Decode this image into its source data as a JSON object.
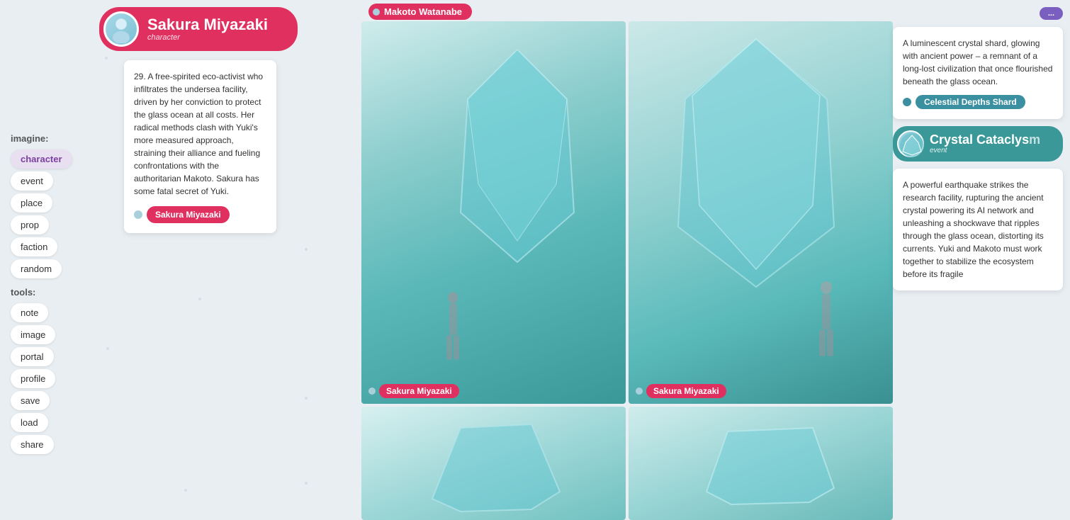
{
  "sidebar": {
    "imagine_label": "imagine:",
    "tools_label": "tools:",
    "imagine_items": [
      {
        "id": "character",
        "label": "character",
        "active": true
      },
      {
        "id": "event",
        "label": "event",
        "active": false
      },
      {
        "id": "place",
        "label": "place",
        "active": false
      },
      {
        "id": "prop",
        "label": "prop",
        "active": false
      },
      {
        "id": "faction",
        "label": "faction",
        "active": false
      },
      {
        "id": "random",
        "label": "random",
        "active": false
      }
    ],
    "tools_items": [
      {
        "id": "note",
        "label": "note"
      },
      {
        "id": "image",
        "label": "image"
      },
      {
        "id": "portal",
        "label": "portal"
      },
      {
        "id": "profile",
        "label": "profile"
      },
      {
        "id": "save",
        "label": "save"
      },
      {
        "id": "load",
        "label": "load"
      },
      {
        "id": "share",
        "label": "share"
      }
    ]
  },
  "character": {
    "name": "Sakura Miyazaki",
    "type_label": "character",
    "description": "29. A free-spirited eco-activist who infiltrates the undersea facility, driven by her conviction to protect the glass ocean at all costs. Her radical methods clash with Yuki's more measured approach, straining their alliance and fueling confrontations with the authoritarian Makoto. Sakura has some fatal secret of Yuki.",
    "tag_name": "Sakura Miyazaki"
  },
  "makoto": {
    "name": "Makoto Watanabe"
  },
  "images": {
    "top_left_tag": "Sakura Miyazaki",
    "top_right_tag": "Sakura Miyazaki",
    "bottom_left_tag": "",
    "bottom_right_tag": ""
  },
  "right_panel": {
    "top_button_label": "...",
    "celestial_shard": {
      "description": "A luminescent crystal shard, glowing with ancient power – a remnant of a long-lost civilization that once flourished beneath the glass ocean.",
      "tag_label": "Celestial Depths Shard"
    },
    "crystal_cataclysm": {
      "title": "Crystal Cataclys",
      "title_full": "Crystal Cataclysm",
      "event_label": "event",
      "description": "A powerful earthquake strikes the research facility, rupturing the ancient crystal powering its AI network and unleashing a shockwave that ripples through the glass ocean, distorting its currents. Yuki and Makoto must work together to stabilize the ecosystem before its fragile"
    }
  }
}
